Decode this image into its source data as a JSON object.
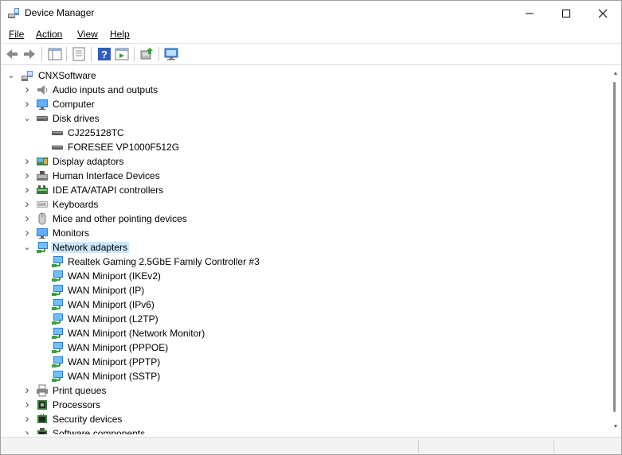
{
  "window": {
    "title": "Device Manager"
  },
  "menu": {
    "file": "File",
    "action": "Action",
    "view": "View",
    "help": "Help"
  },
  "toolbar": [
    "back-icon",
    "forward-icon",
    "show-hide-tree-icon",
    "properties-icon",
    "help-icon",
    "run-icon",
    "update-driver-icon",
    "scan-hardware-icon"
  ],
  "tree": {
    "root": "CNXSoftware",
    "categories": [
      {
        "label": "Audio inputs and outputs",
        "icon": "speaker-icon",
        "expanded": false
      },
      {
        "label": "Computer",
        "icon": "computer-icon",
        "expanded": false
      },
      {
        "label": "Disk drives",
        "icon": "disk-drive-icon",
        "expanded": true,
        "children": [
          "CJ225128TC",
          "FORESEE VP1000F512G"
        ]
      },
      {
        "label": "Display adaptors",
        "icon": "display-adapter-icon",
        "expanded": false
      },
      {
        "label": "Human Interface Devices",
        "icon": "hid-icon",
        "expanded": false
      },
      {
        "label": "IDE ATA/ATAPI controllers",
        "icon": "ide-controller-icon",
        "expanded": false
      },
      {
        "label": "Keyboards",
        "icon": "keyboard-icon",
        "expanded": false
      },
      {
        "label": "Mice and other pointing devices",
        "icon": "mouse-icon",
        "expanded": false
      },
      {
        "label": "Monitors",
        "icon": "monitor-icon",
        "expanded": false
      },
      {
        "label": "Network adapters",
        "icon": "network-adapter-icon",
        "expanded": true,
        "selected": true,
        "children": [
          "Realtek Gaming 2.5GbE Family Controller #3",
          "WAN Miniport (IKEv2)",
          "WAN Miniport (IP)",
          "WAN Miniport (IPv6)",
          "WAN Miniport (L2TP)",
          "WAN Miniport (Network Monitor)",
          "WAN Miniport (PPPOE)",
          "WAN Miniport (PPTP)",
          "WAN Miniport (SSTP)"
        ]
      },
      {
        "label": "Print queues",
        "icon": "printer-icon",
        "expanded": false
      },
      {
        "label": "Processors",
        "icon": "processor-icon",
        "expanded": false
      },
      {
        "label": "Security devices",
        "icon": "security-device-icon",
        "expanded": false
      },
      {
        "label": "Software components",
        "icon": "software-component-icon",
        "expanded": false
      }
    ]
  },
  "colors": {
    "selection": "#cce8ff",
    "window_bg": "#ffffff",
    "chrome_bg": "#f3f3f3"
  }
}
